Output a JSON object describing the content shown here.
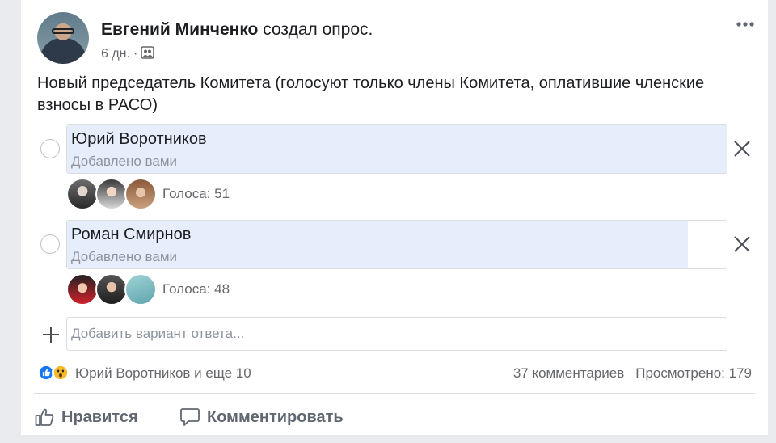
{
  "post": {
    "author": "Евгений Минченко",
    "action": "создал опрос.",
    "time": "6 дн.",
    "meta_separator": "·",
    "audience_icon": "group-icon",
    "text": "Новый председатель Комитета (голосуют только члены Комитета, оплатившие членские взносы в РАСО)"
  },
  "poll": {
    "options": [
      {
        "name": "Юрий Воротников",
        "added_by": "Добавлено вами",
        "votes_label": "Голоса: 51",
        "votes": 51,
        "fill_fraction": 1.0
      },
      {
        "name": "Роман Смирнов",
        "added_by": "Добавлено вами",
        "votes_label": "Голоса: 48",
        "votes": 48,
        "fill_fraction": 0.941
      }
    ],
    "add_placeholder": "Добавить вариант ответа..."
  },
  "footer": {
    "reactors": "Юрий Воротников и еще 10",
    "reaction_icons": [
      "like-icon",
      "wow-icon"
    ],
    "comments": "37 комментариев",
    "views": "Просмотрено: 179",
    "like_label": "Нравится",
    "comment_label": "Комментировать"
  },
  "colors": {
    "accent": "#1877f2",
    "poll_fill": "#e7eefb",
    "muted_text": "#65676b"
  }
}
